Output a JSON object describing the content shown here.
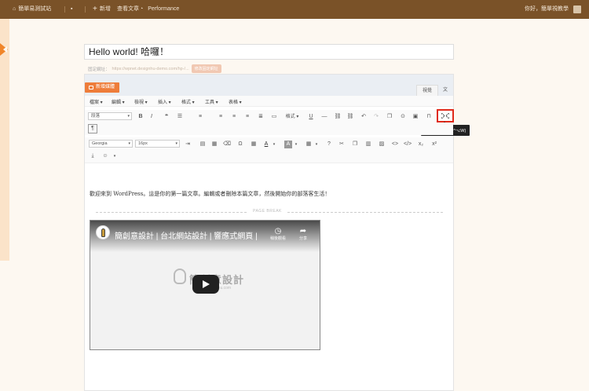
{
  "admin_bar": {
    "site_name": "簡單易測試站",
    "new_label": "新增",
    "view_posts_label": "查看文章",
    "performance_label": "Performance",
    "greeting": "你好，簡單視教學"
  },
  "editor": {
    "title_value": "Hello world! 哈囉！",
    "permalink_label": "固定網址：",
    "permalink_url": "https://wpnet.designhu-demo.com/hp-/...",
    "permalink_button": "修改固定網址",
    "add_media_label": "新增媒體",
    "tab_visual": "視覺",
    "tab_text": "文字",
    "menubar": [
      "檔案",
      "編輯",
      "檢視",
      "插入",
      "格式",
      "工具",
      "表格"
    ],
    "paragraph_select": "段落",
    "formats_select": "格式",
    "font_select": "Georgia",
    "size_select": "16px",
    "tooltip": "專注寫作模式 (^⌥W)",
    "body_text": "歡迎來到 WordPress。這是你的第一篇文章。編輯或者刪除本篇文章，然後開始你的部落客生活！",
    "page_break_label": "PAGE BREAK"
  },
  "video": {
    "title": "簡創意設計 | 台北網站設計 | 響應式網頁 |",
    "watch_later_label": "稍後觀看",
    "share_label": "分享",
    "brand_text": "簡創意設計",
    "brand_sub": "www.designhu.com"
  },
  "colors": {
    "admin_bar_bg": "#7a5228",
    "accent": "#ee7d3a",
    "highlight_border": "#e02a1b"
  }
}
